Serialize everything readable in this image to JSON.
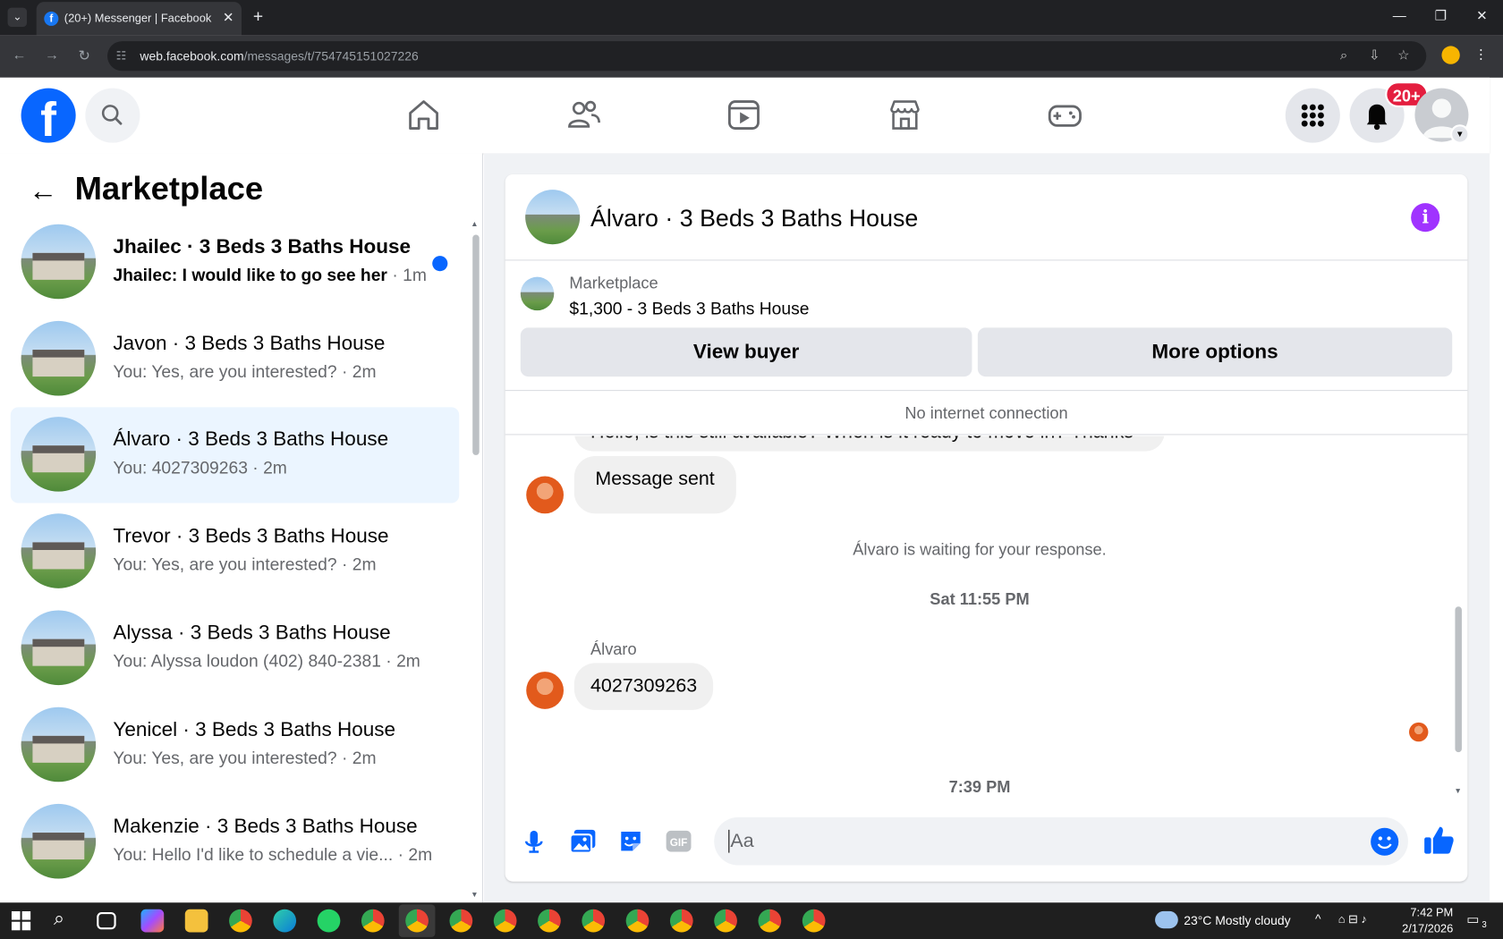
{
  "browser": {
    "tab_title": "(20+) Messenger | Facebook",
    "url_domain": "web.facebook.com",
    "url_path": "/messages/t/754745151027226"
  },
  "header": {
    "notification_badge": "20+",
    "colors": {
      "brand": "#0866ff",
      "badge": "#e41e3f"
    }
  },
  "left_panel": {
    "title": "Marketplace",
    "conversations": [
      {
        "name": "Jhailec · 3 Beds 3 Baths House",
        "preview": "Jhailec: I would like to go see her",
        "time": "· 1m",
        "unread": true,
        "selected": false
      },
      {
        "name": "Javon · 3 Beds 3 Baths House",
        "preview": "You: Yes, are you interested? · 2m",
        "time": "",
        "unread": false,
        "selected": false
      },
      {
        "name": "Álvaro · 3 Beds 3 Baths House",
        "preview": "You: 4027309263 · 2m",
        "time": "",
        "unread": false,
        "selected": true
      },
      {
        "name": "Trevor · 3 Beds 3 Baths House",
        "preview": "You: Yes, are you interested? · 2m",
        "time": "",
        "unread": false,
        "selected": false
      },
      {
        "name": "Alyssa · 3 Beds 3 Baths House",
        "preview": "You: Alyssa loudon (402) 840-2381 · 2m",
        "time": "",
        "unread": false,
        "selected": false
      },
      {
        "name": "Yenicel · 3 Beds 3 Baths House",
        "preview": "You: Yes, are you interested? · 2m",
        "time": "",
        "unread": false,
        "selected": false
      },
      {
        "name": "Makenzie · 3 Beds 3 Baths House",
        "preview": "You: Hello I'd like to schedule a vie...  · 2m",
        "time": "",
        "unread": false,
        "selected": false
      }
    ]
  },
  "chat": {
    "title": "Álvaro · 3 Beds 3 Baths House",
    "listing_label": "Marketplace",
    "listing_price": "$1,300 - 3 Beds 3 Baths House",
    "view_buyer": "View buyer",
    "more_options": "More options",
    "status": "No internet connection",
    "partial_message": "Hello, is this still available? When is it ready to move in? Thanks",
    "message_sent": "Message sent",
    "waiting_notice": "Álvaro is waiting for your response.",
    "timestamp_1": "Sat 11:55 PM",
    "sender": "Álvaro",
    "phone_message": "4027309263",
    "timestamp_2": "7:39 PM",
    "composer_placeholder": "Aa"
  },
  "taskbar": {
    "weather": "23°C  Mostly cloudy",
    "time": "7:42 PM",
    "date": "2/17/2026",
    "notifications": "3"
  }
}
